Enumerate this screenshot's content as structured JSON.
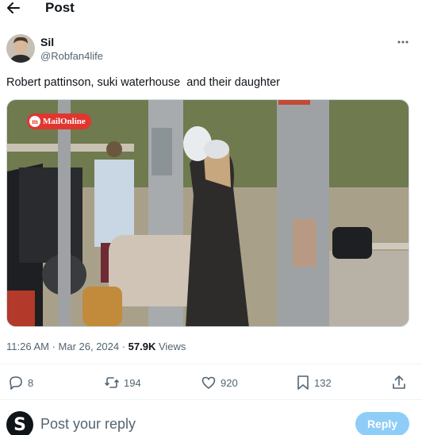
{
  "header": {
    "title": "Post",
    "back_icon": "arrow-left-icon"
  },
  "post": {
    "author": {
      "name": "Sil",
      "handle": "@Robfan4life"
    },
    "more_icon": "more-horizontal-icon",
    "text": "Robert pattinson, suki waterhouse  and their daughter",
    "media": {
      "watermark_text": "MailOnline",
      "watermark_logo": "m"
    },
    "meta": {
      "timestamp": "11:26 AM · Mar 26, 2024 · ",
      "views_count": "57.9K",
      "views_label": " Views"
    },
    "actions": {
      "reply": {
        "icon": "reply-icon",
        "count": "8"
      },
      "repost": {
        "icon": "repost-icon",
        "count": "194"
      },
      "like": {
        "icon": "heart-icon",
        "count": "920"
      },
      "bookmark": {
        "icon": "bookmark-icon",
        "count": "132"
      },
      "share": {
        "icon": "share-icon"
      }
    }
  },
  "reply_bar": {
    "avatar_letter": "S",
    "placeholder": "Post your reply",
    "button_label": "Reply"
  },
  "colors": {
    "text": "#0f1419",
    "secondary": "#536471",
    "reply_button": "#8ecdf8",
    "divider": "#eff3f4"
  }
}
